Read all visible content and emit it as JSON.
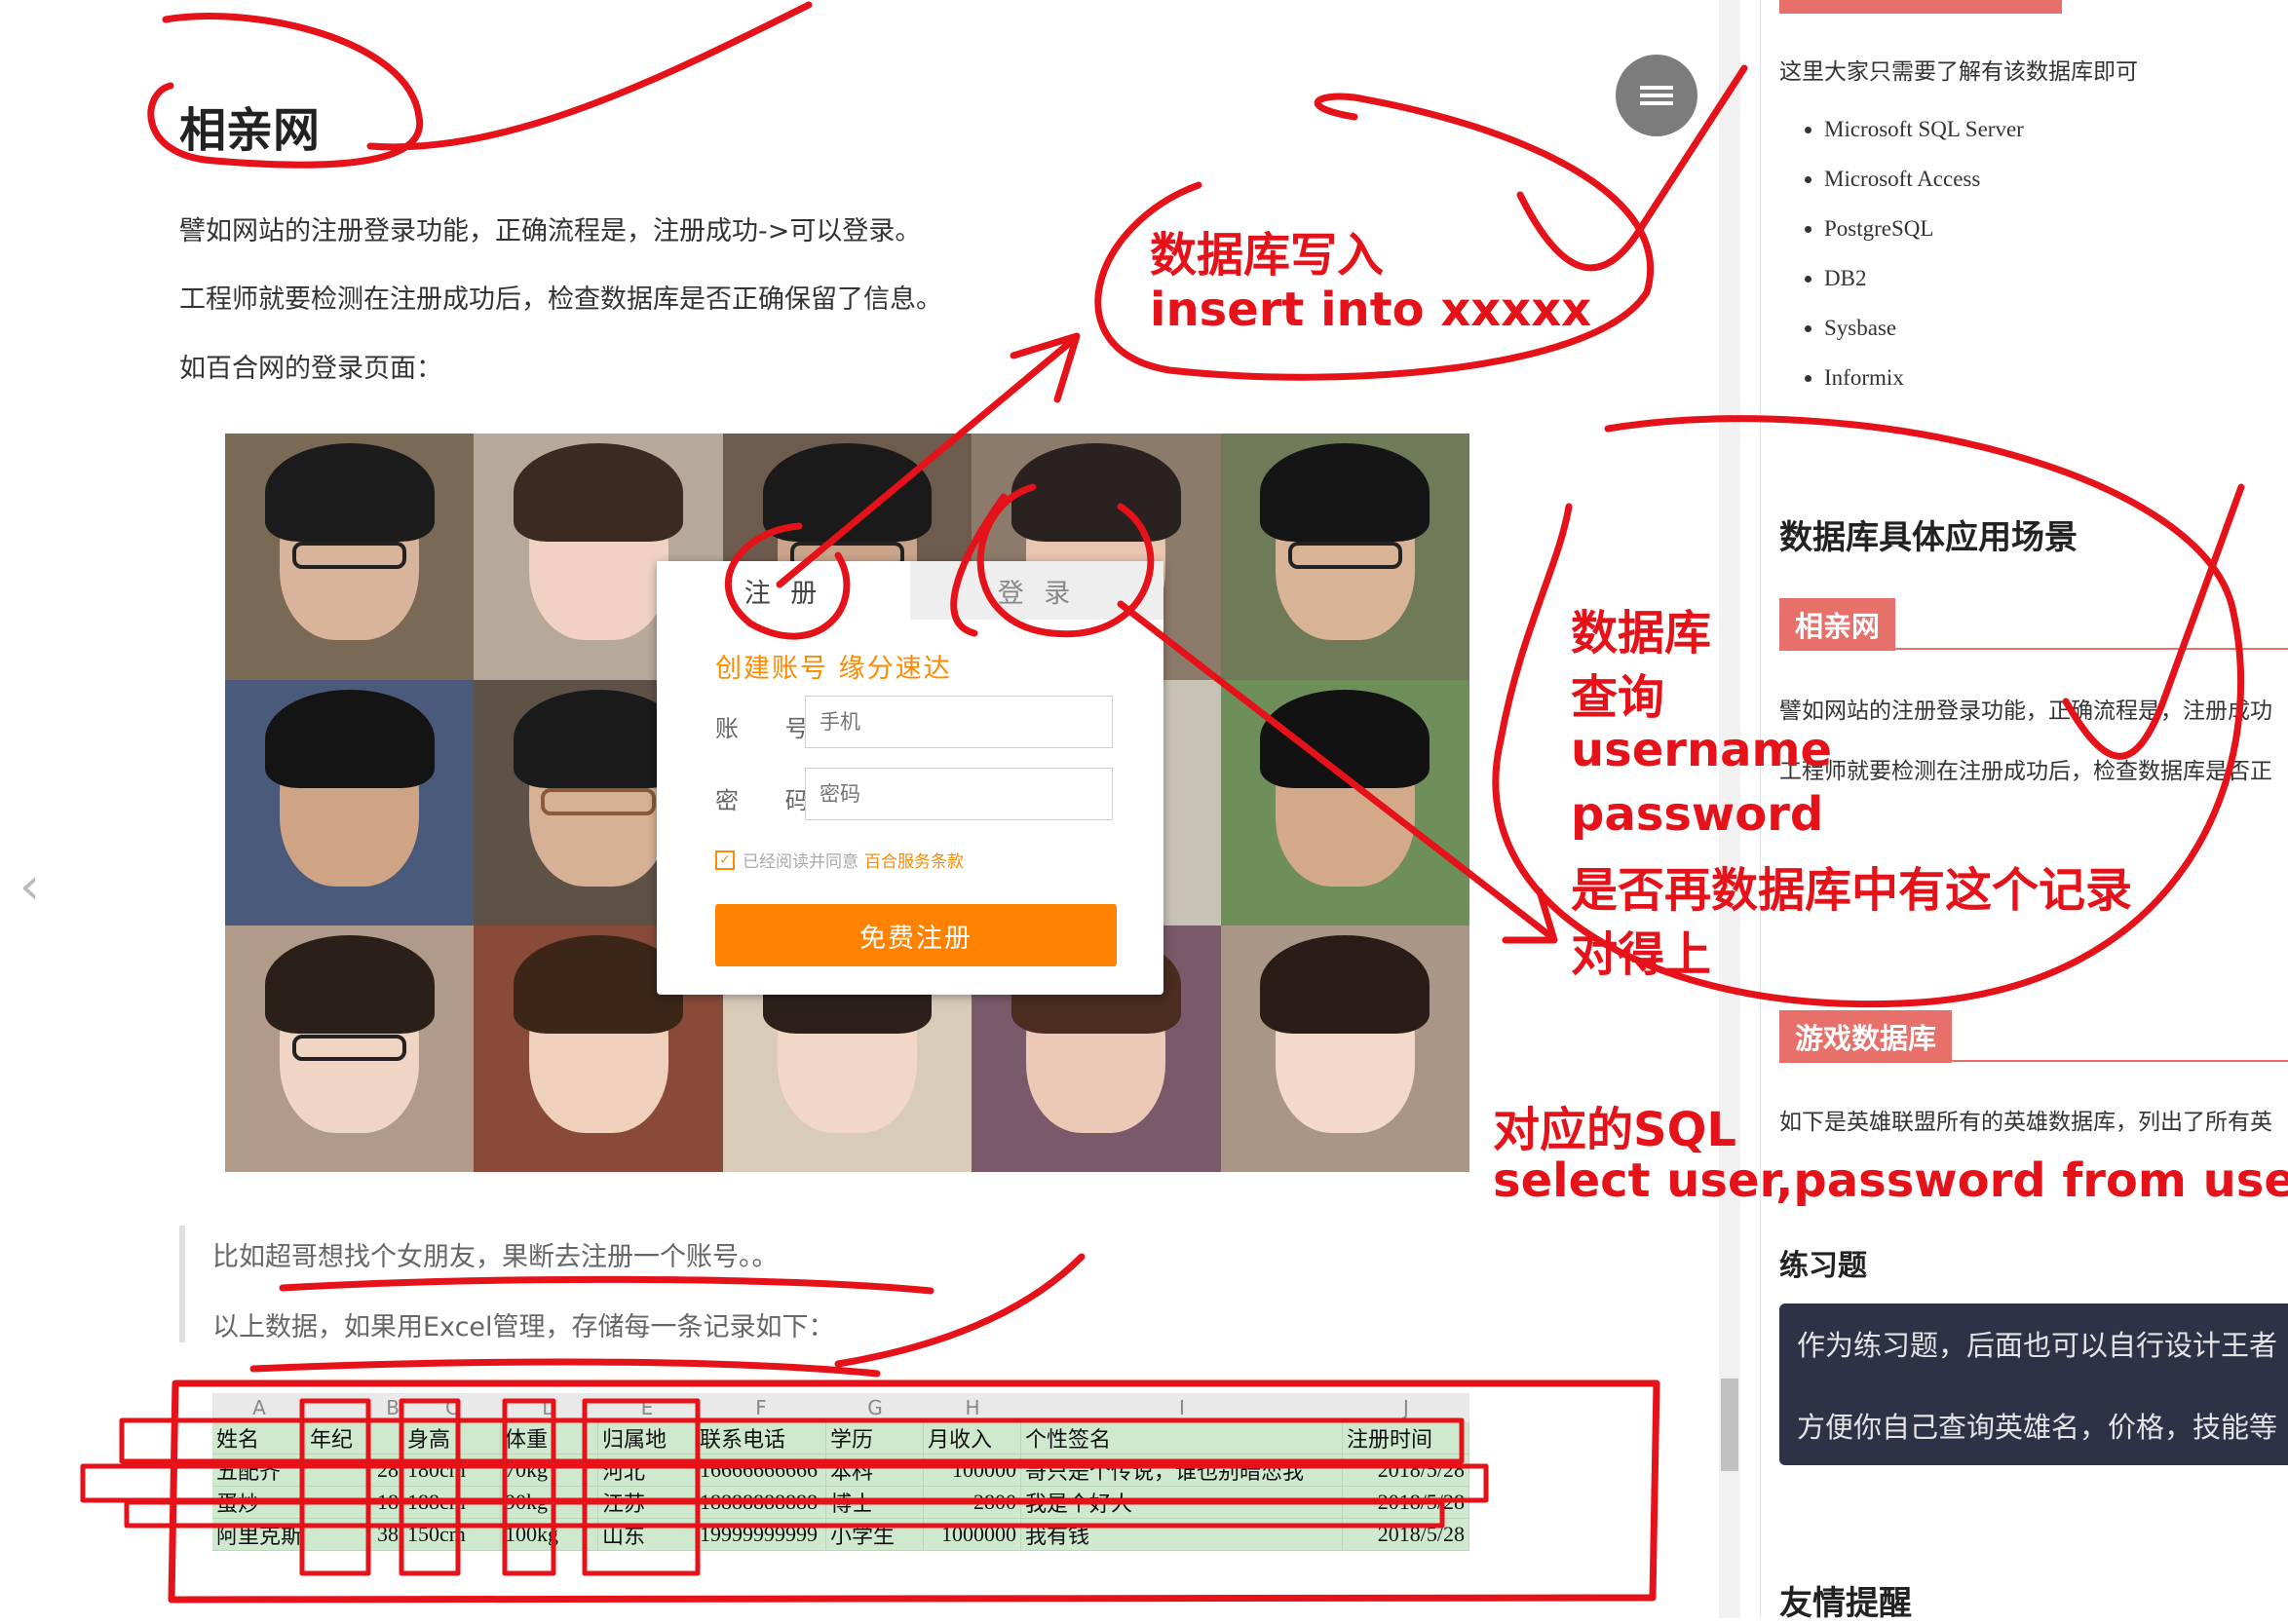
{
  "article": {
    "title": "相亲网",
    "paragraphs": [
      "譬如网站的注册登录功能，正确流程是，注册成功->可以登录。",
      "工程师就要检测在注册成功后，检查数据库是否正确保留了信息。",
      "如百合网的登录页面："
    ],
    "quotes": [
      "比如超哥想找个女朋友，果断去注册一个账号。。",
      "以上数据，如果用Excel管理，存储每一条记录如下："
    ]
  },
  "register_dialog": {
    "tab_register": "注 册",
    "tab_login": "登 录",
    "slogan": "创建账号  缘分速达",
    "account_label": "账 号",
    "account_placeholder": "手机",
    "password_label": "密 码",
    "password_placeholder": "密码",
    "agree_text": "已经阅读并同意",
    "agree_link": "百合服务条款",
    "submit": "免费注册"
  },
  "spreadsheet": {
    "column_letters": [
      "A",
      "B",
      "C",
      "D",
      "E",
      "F",
      "G",
      "H",
      "I",
      "J"
    ],
    "headers": [
      "姓名",
      "年纪",
      "身高",
      "体重",
      "归属地",
      "联系电话",
      "学历",
      "月收入",
      "个性签名",
      "注册时间"
    ],
    "rows": [
      [
        "五配齐",
        "28",
        "180cm",
        "70kg",
        "河北",
        "16666666666",
        "本科",
        "100000",
        "哥只是个传说，谁也别暗恋我",
        "2018/5/28"
      ],
      [
        "蛋炒",
        "18",
        "188cm",
        "90kg",
        "江苏",
        "18888888888",
        "博士",
        "2800",
        "我是个好人",
        "2018/5/28"
      ],
      [
        "阿里克斯",
        "38",
        "150cm",
        "100kg",
        "山东",
        "19999999999",
        "小学生",
        "1000000",
        "我有钱",
        "2018/5/28"
      ]
    ]
  },
  "right_panel": {
    "intro": "这里大家只需要了解有该数据库即可",
    "databases": [
      "Microsoft SQL Server",
      "Microsoft Access",
      "PostgreSQL",
      "DB2",
      "Sysbase",
      "Informix"
    ],
    "scenarios_heading": "数据库具体应用场景",
    "tag_dating": "相亲网",
    "dating_line1": "譬如网站的注册登录功能，正确流程是，注册成功",
    "dating_line2": "工程师就要检测在注册成功后，检查数据库是否正",
    "tag_game": "游戏数据库",
    "game_line": "如下是英雄联盟所有的英雄数据库，列出了所有英",
    "exercise_heading": "练习题",
    "exercise_line1": "作为练习题，后面也可以自行设计王者",
    "exercise_line2": "方便你自己查询英雄名，价格，技能等",
    "reminder_heading": "友情提醒"
  },
  "annotations": {
    "db_write": "数据库写入",
    "insert_sql": "insert into   xxxxx",
    "db_query_1": "数据库",
    "db_query_2": "查询",
    "username": "username",
    "password": "password",
    "check_record": "是否再数据库中有这个记录",
    "match": "对得上",
    "sql_label": "对应的SQL",
    "select_sql": "select  user,password from user;"
  },
  "colors": {
    "annotation_red": "#e5121a",
    "tag_salmon": "#e8706b",
    "brand_orange": "#ff8200",
    "sheet_green": "#cfe9cf",
    "dark_box": "#2e3247"
  },
  "icons": {
    "menu": "hamburger-menu-icon",
    "prev": "chevron-left-icon"
  }
}
